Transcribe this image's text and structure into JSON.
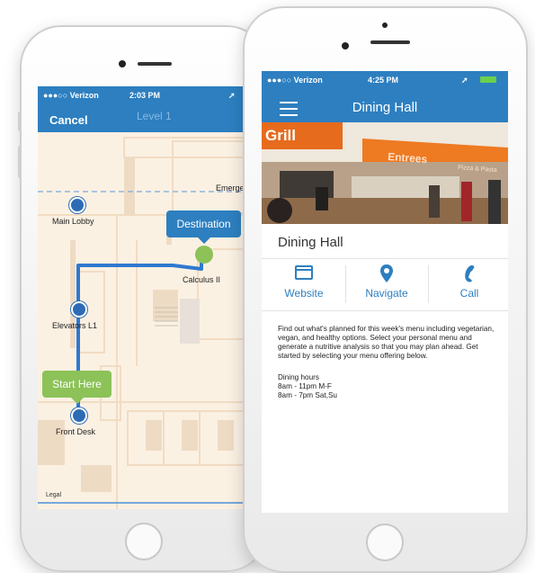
{
  "left_phone": {
    "status": {
      "carrier": "●●●○○ Verizon",
      "time": "2:03 PM"
    },
    "nav": {
      "cancel_label": "Cancel",
      "title": "Level 1"
    },
    "map_labels": {
      "emergency": "Emerge",
      "main_lobby": "Main Lobby",
      "calculus": "Calculus II",
      "elevators": "Elevators L1",
      "front_desk": "Front Desk",
      "legal": "Legal"
    },
    "bubbles": {
      "destination": "Destination",
      "start": "Start Here"
    }
  },
  "right_phone": {
    "status": {
      "carrier": "●●●○○ Verizon",
      "time": "4:25 PM"
    },
    "nav": {
      "title": "Dining Hall"
    },
    "photo_signs": {
      "grill": "Grill",
      "entrees": "Entrees",
      "pizza": "Pizza & Pasta"
    },
    "venue_name": "Dining Hall",
    "actions": {
      "website": "Website",
      "navigate": "Navigate",
      "call": "Call"
    },
    "description": "Find out what's planned for this week's menu including vegetarian, vegan, and healthy options. Select your personal menu and generate a nutritive analysis so that you may plan ahead. Get started by selecting your menu offering below.",
    "hours": {
      "title": "Dining hours",
      "line1": "8am - 11pm M-F",
      "line2": "8am - 7pm Sat,Su"
    }
  },
  "colors": {
    "brand_blue": "#2d7fc0",
    "accent_green": "#8cc258",
    "map_bg": "#fbf1e3"
  },
  "icons": [
    "wifi-icon",
    "battery-icon",
    "menu-icon",
    "website-icon",
    "location-pin-icon",
    "phone-icon",
    "elevator-icon",
    "lobby-icon",
    "front-desk-icon"
  ]
}
